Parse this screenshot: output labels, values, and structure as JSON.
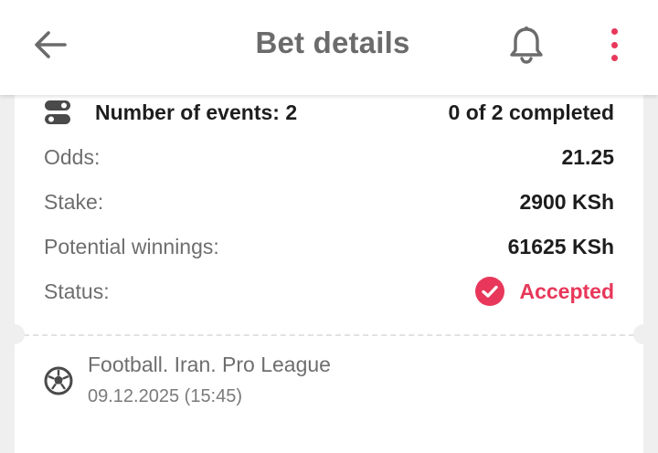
{
  "header": {
    "title": "Bet details",
    "back_icon": "arrow-left-icon",
    "bell_icon": "bell-icon",
    "menu_icon": "more-vertical-icon",
    "accent_color": "#e8375a"
  },
  "summary": {
    "events_label": "Number of events: 2",
    "events_progress": "0 of 2 completed",
    "odds_label": "Odds:",
    "odds_value": "21.25",
    "stake_label": "Stake:",
    "stake_value": "2900 KSh",
    "winnings_label": "Potential winnings:",
    "winnings_value": "61625 KSh",
    "status_label": "Status:",
    "status_value": "Accepted",
    "status_icon": "check-circle-icon",
    "events_icon": "toggles-icon"
  },
  "event": {
    "sport_icon": "football-icon",
    "league": "Football. Iran. Pro League",
    "datetime": "09.12.2025 (15:45)"
  }
}
